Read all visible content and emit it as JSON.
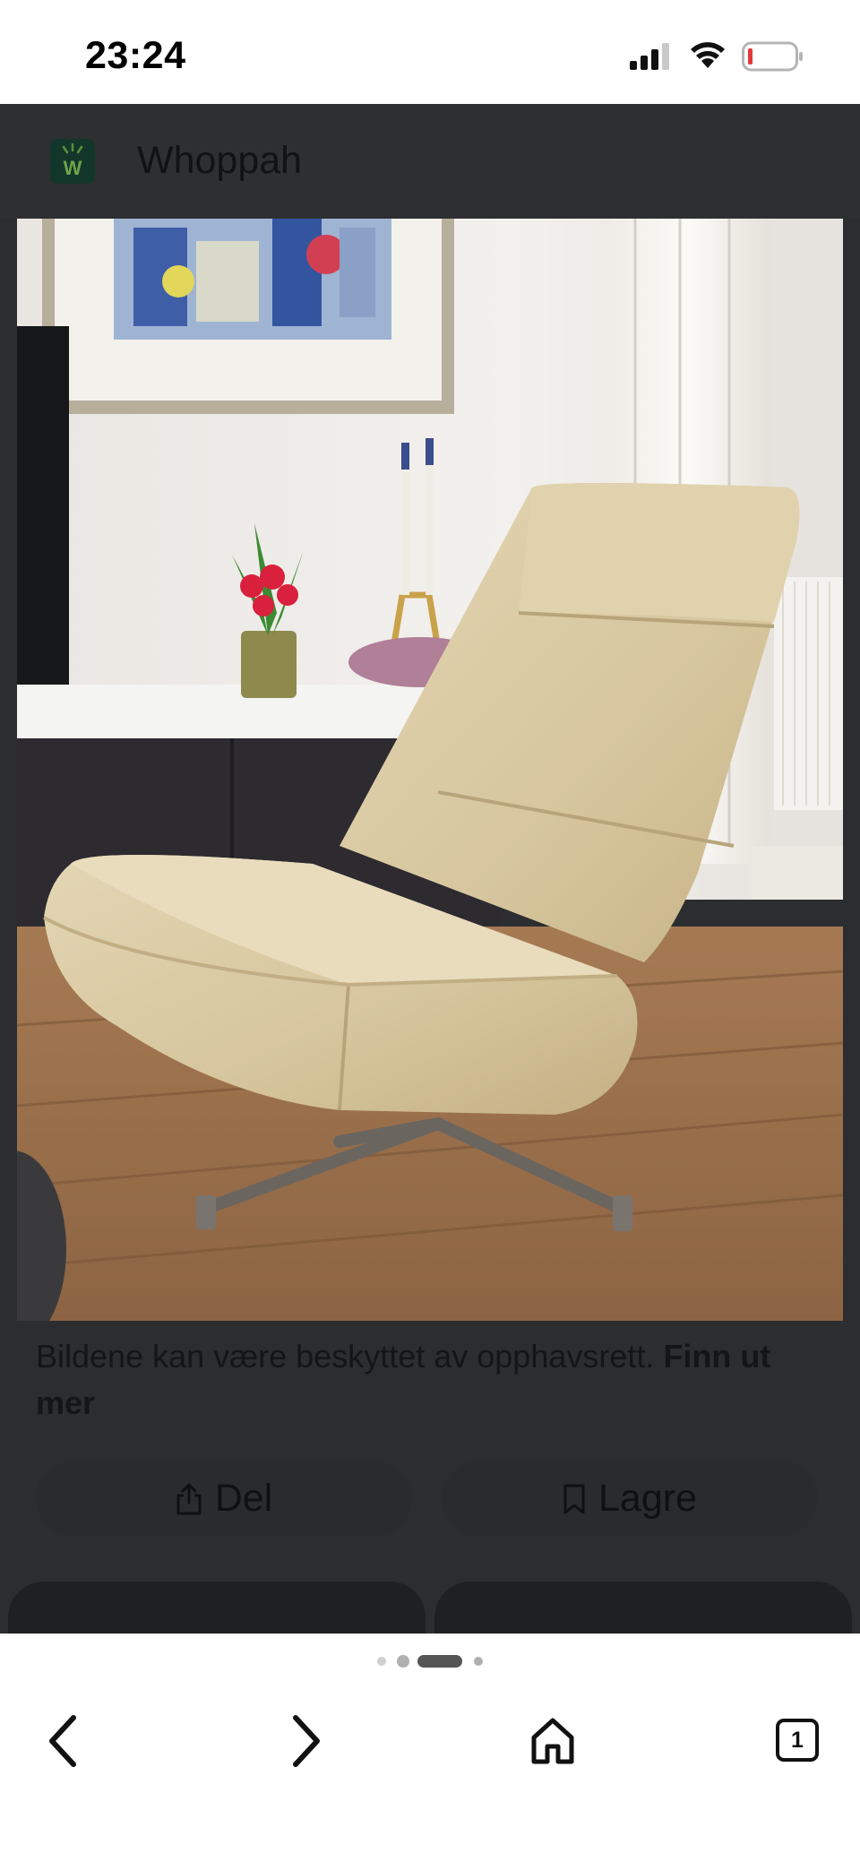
{
  "status_bar": {
    "time": "23:24",
    "icons": [
      "signal-icon",
      "wifi-icon",
      "battery-low-icon"
    ]
  },
  "site": {
    "name": "Whoppah",
    "logo_icon": "whoppah-logo-icon",
    "logo_letter": "W"
  },
  "caption": {
    "text": "Bildene kan være beskyttet av opphavsrett.",
    "link": "Finn ut mer"
  },
  "actions": {
    "share_label": "Del",
    "share_icon": "share-icon",
    "save_label": "Lagre",
    "save_icon": "bookmark-icon"
  },
  "browser": {
    "tab_count": "1",
    "icons": [
      "back-icon",
      "forward-icon",
      "home-icon",
      "tabs-icon"
    ],
    "page_indicator": {
      "count": 4,
      "active_index": 2
    }
  },
  "colors": {
    "overlay": "#2c2d30",
    "logo_bg": "#12372a",
    "chair": "#d8c9a2"
  }
}
